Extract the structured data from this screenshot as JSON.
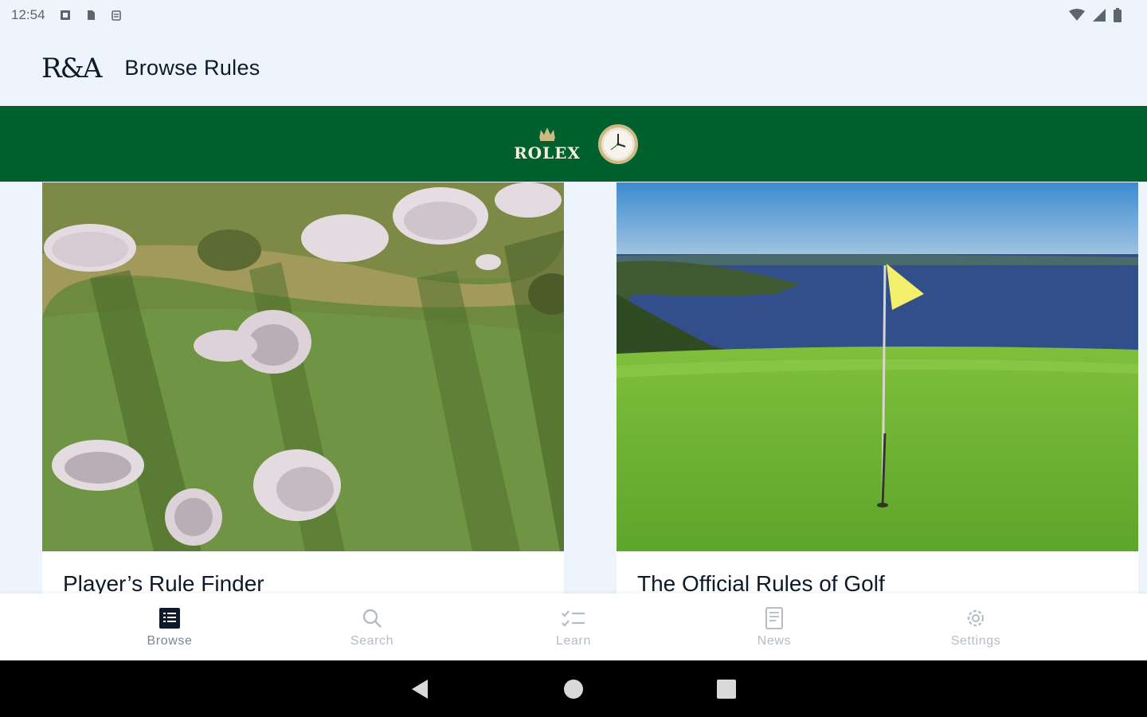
{
  "status_bar": {
    "time": "12:54",
    "left_icons": [
      "notification-icon",
      "sd-card-icon",
      "clipboard-icon"
    ],
    "right_icons": [
      "wifi-icon",
      "signal-icon",
      "battery-icon"
    ]
  },
  "app_bar": {
    "logo": "R&A",
    "title": "Browse Rules"
  },
  "sponsor": {
    "brand": "ROLEX",
    "colors": {
      "background": "#00612e",
      "gold": "#cdb982"
    }
  },
  "cards": [
    {
      "title": "Player’s Rule Finder",
      "image": "aerial golf course with bunkers"
    },
    {
      "title": "The Official Rules of Golf",
      "image": "golf green with flag beside sea cliffs"
    }
  ],
  "bottom_nav": {
    "items": [
      {
        "label": "Browse",
        "icon": "browse-icon",
        "active": true
      },
      {
        "label": "Search",
        "icon": "search-icon",
        "active": false
      },
      {
        "label": "Learn",
        "icon": "learn-icon",
        "active": false
      },
      {
        "label": "News",
        "icon": "news-icon",
        "active": false
      },
      {
        "label": "Settings",
        "icon": "settings-icon",
        "active": false
      }
    ]
  },
  "system_nav": {
    "buttons": [
      "back-icon",
      "home-icon",
      "recents-icon"
    ]
  }
}
